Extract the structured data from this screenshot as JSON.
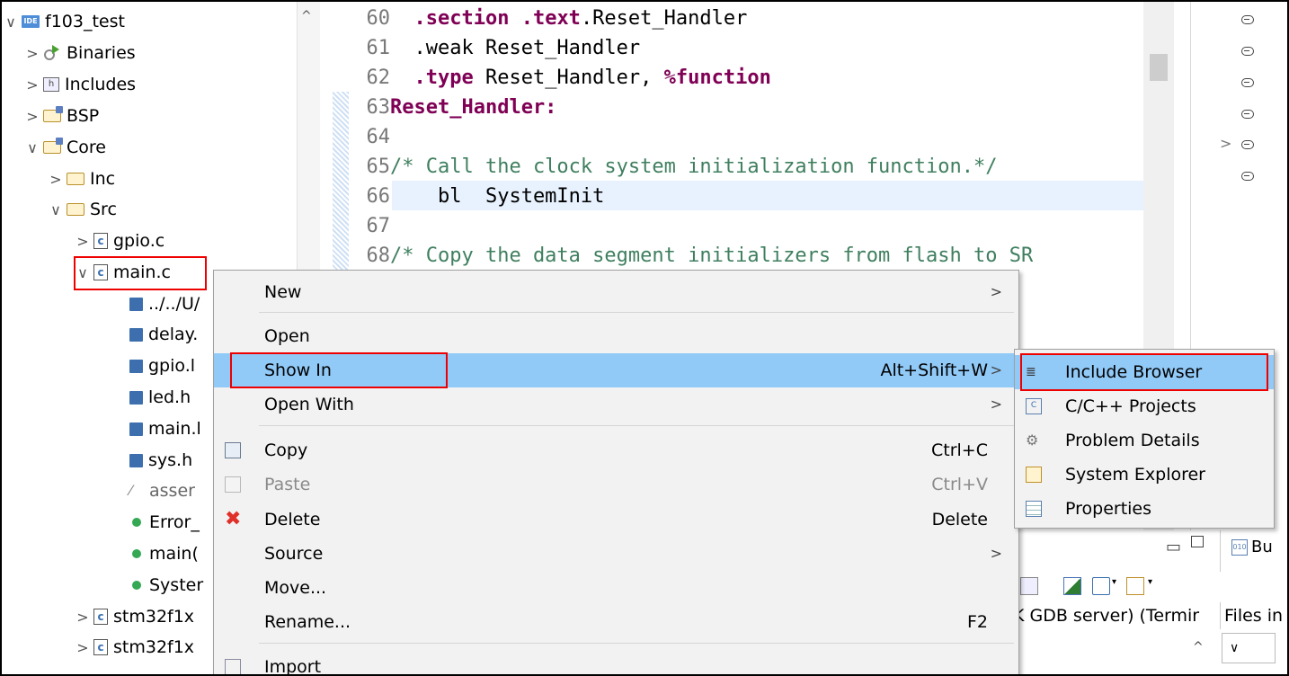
{
  "tree": {
    "rows": [
      {
        "label": "f103_test",
        "chev": "∨",
        "icon": "IDE"
      },
      {
        "label": "Binaries",
        "chev": ">"
      },
      {
        "label": "Includes",
        "chev": ">",
        "icon": "h"
      },
      {
        "label": "BSP",
        "chev": ">"
      },
      {
        "label": "Core",
        "chev": "∨"
      },
      {
        "label": "Inc",
        "chev": ">"
      },
      {
        "label": "Src",
        "chev": "∨"
      },
      {
        "label": "gpio.c",
        "chev": ">",
        "icon": "c"
      },
      {
        "label": "main.c",
        "chev": "∨",
        "icon": "c"
      },
      {
        "label": "../../U/"
      },
      {
        "label": "delay."
      },
      {
        "label": "gpio.l"
      },
      {
        "label": "led.h"
      },
      {
        "label": "main.l"
      },
      {
        "label": "sys.h"
      },
      {
        "label": "asser"
      },
      {
        "label": "Error_"
      },
      {
        "label": "main("
      },
      {
        "label": "Syster"
      },
      {
        "label": "stm32f1x",
        "chev": ">",
        "icon": "c"
      },
      {
        "label": "stm32f1x",
        "chev": ">",
        "icon": "c"
      }
    ],
    "scroll_up": "^"
  },
  "editor": {
    "lines": [
      {
        "num": "60",
        "parts": [
          {
            "t": "  "
          },
          {
            "t": ".section .text",
            "c": "kw"
          },
          {
            "t": ".Reset_Handler"
          }
        ]
      },
      {
        "num": "61",
        "parts": [
          {
            "t": "  .weak Reset_Handler"
          }
        ]
      },
      {
        "num": "62",
        "parts": [
          {
            "t": "  "
          },
          {
            "t": ".type",
            "c": "kw"
          },
          {
            "t": " Reset_Handler, "
          },
          {
            "t": "%function",
            "c": "kw"
          }
        ]
      },
      {
        "num": "63",
        "parts": [
          {
            "t": "Reset_Handler:",
            "c": "lbl"
          }
        ]
      },
      {
        "num": "64",
        "parts": [
          {
            "t": ""
          }
        ]
      },
      {
        "num": "65",
        "parts": [
          {
            "t": "/* Call the clock system initialization function.*/",
            "c": "cmt"
          }
        ]
      },
      {
        "num": "66",
        "parts": [
          {
            "t": "    bl  SystemInit"
          }
        ]
      },
      {
        "num": "67",
        "parts": [
          {
            "t": ""
          }
        ]
      },
      {
        "num": "68",
        "parts": [
          {
            "t": "/* Copy the data segment initializers from flash to SR",
            "c": "cmt"
          }
        ]
      }
    ]
  },
  "context_menu": {
    "items": [
      {
        "label": "New",
        "shortcut": "",
        "submenu": true
      },
      {
        "label": "Open",
        "shortcut": "",
        "submenu": false
      },
      {
        "label": "Show In",
        "shortcut": "Alt+Shift+W",
        "submenu": true
      },
      {
        "label": "Open With",
        "shortcut": "",
        "submenu": true
      },
      {
        "label": "Copy",
        "shortcut": "Ctrl+C",
        "submenu": false
      },
      {
        "label": "Paste",
        "shortcut": "Ctrl+V",
        "submenu": false
      },
      {
        "label": "Delete",
        "shortcut": "Delete",
        "submenu": false
      },
      {
        "label": "Source",
        "shortcut": "",
        "submenu": true
      },
      {
        "label": "Move...",
        "shortcut": "",
        "submenu": false
      },
      {
        "label": "Rename...",
        "shortcut": "F2",
        "submenu": false
      },
      {
        "label": "Import",
        "shortcut": "",
        "submenu": false
      }
    ],
    "arrow": ">"
  },
  "submenu": {
    "items": [
      {
        "label": "Include Browser"
      },
      {
        "label": "C/C++ Projects"
      },
      {
        "label": "Problem Details"
      },
      {
        "label": "System Explorer"
      },
      {
        "label": "Properties"
      }
    ]
  },
  "bottom_panel": {
    "tab_label": "Bu",
    "console_title": "K GDB server) (Termir",
    "files_title": "Files in",
    "scroll_up": "^",
    "dropdown": "∨"
  },
  "outline": {
    "chev": ">"
  },
  "colors": {
    "highlight": "#91c9f7",
    "menu_bg": "#f2f2f2",
    "annotation_red": "#e00000",
    "keyword": "#7f0055",
    "comment": "#3f7f5f"
  }
}
